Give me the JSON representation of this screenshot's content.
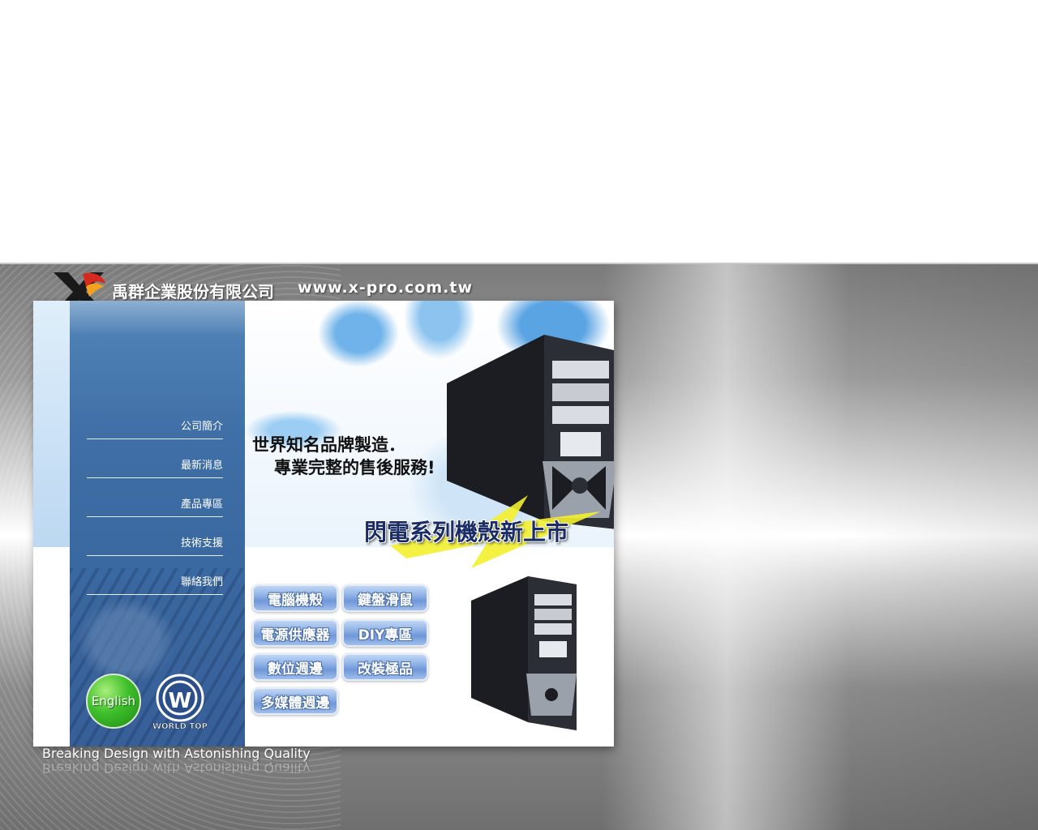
{
  "header": {
    "company_name": "禹群企業股份有限公司",
    "url": "www.x-pro.com.tw"
  },
  "sidebar": {
    "items": [
      {
        "label": "公司簡介"
      },
      {
        "label": "最新消息"
      },
      {
        "label": "產品專區"
      },
      {
        "label": "技術支援"
      },
      {
        "label": "聯絡我們"
      }
    ],
    "english_label": "English",
    "world_top_label": "WORLD TOP"
  },
  "hero": {
    "slogan_line1": "世界知名品牌製造．",
    "slogan_line2": "專業完整的售後服務!",
    "banner": "閃電系列機殼新上市"
  },
  "categories": [
    {
      "label": "電腦機殼"
    },
    {
      "label": "鍵盤滑鼠"
    },
    {
      "label": "電源供應器"
    },
    {
      "label": "DIY專區"
    },
    {
      "label": "數位週邊"
    },
    {
      "label": "改裝極品"
    },
    {
      "label": "多媒體週邊"
    }
  ],
  "footer": {
    "tagline": "Breaking Design with Astonishing Quality"
  },
  "colors": {
    "sidebar_blue": "#3f6fa6",
    "button_blue": "#6f97d8",
    "english_green": "#3fbf2c"
  }
}
